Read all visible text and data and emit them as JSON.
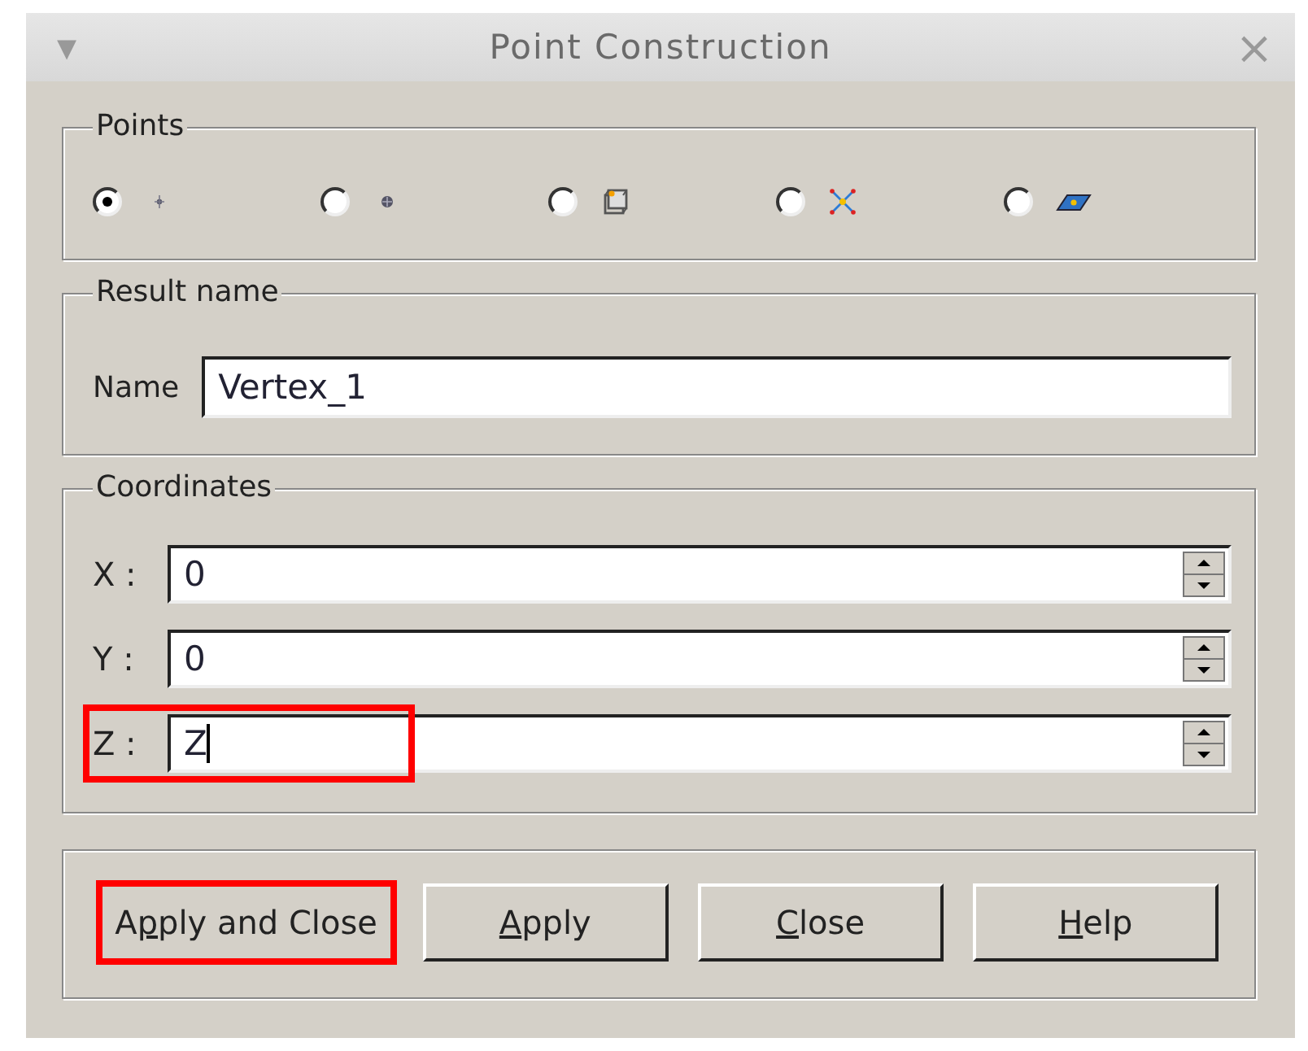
{
  "window": {
    "title": "Point Construction",
    "menu_glyph": "▾",
    "close_glyph": "×"
  },
  "points": {
    "title": "Points",
    "options": [
      {
        "kind": "xyz",
        "selected": true
      },
      {
        "kind": "reference",
        "selected": false
      },
      {
        "kind": "on-edge",
        "selected": false
      },
      {
        "kind": "intersection",
        "selected": false
      },
      {
        "kind": "on-face",
        "selected": false
      }
    ]
  },
  "result_name": {
    "title": "Result name",
    "label": "Name",
    "value": "Vertex_1"
  },
  "coordinates": {
    "title": "Coordinates",
    "rows": [
      {
        "label": "X :",
        "value": "0",
        "highlighted": false,
        "focused": false
      },
      {
        "label": "Y :",
        "value": "0",
        "highlighted": false,
        "focused": false
      },
      {
        "label": "Z :",
        "value": "Z",
        "highlighted": true,
        "focused": true
      }
    ]
  },
  "buttons": [
    {
      "before": "A",
      "mnemonic": "p",
      "after": "ply and Close",
      "default": true,
      "highlighted": true
    },
    {
      "mnemonic": "A",
      "after": "pply",
      "default": false,
      "highlighted": false
    },
    {
      "mnemonic": "C",
      "after": "lose",
      "default": false,
      "highlighted": false
    },
    {
      "mnemonic": "H",
      "after": "elp",
      "default": false,
      "highlighted": false
    }
  ]
}
